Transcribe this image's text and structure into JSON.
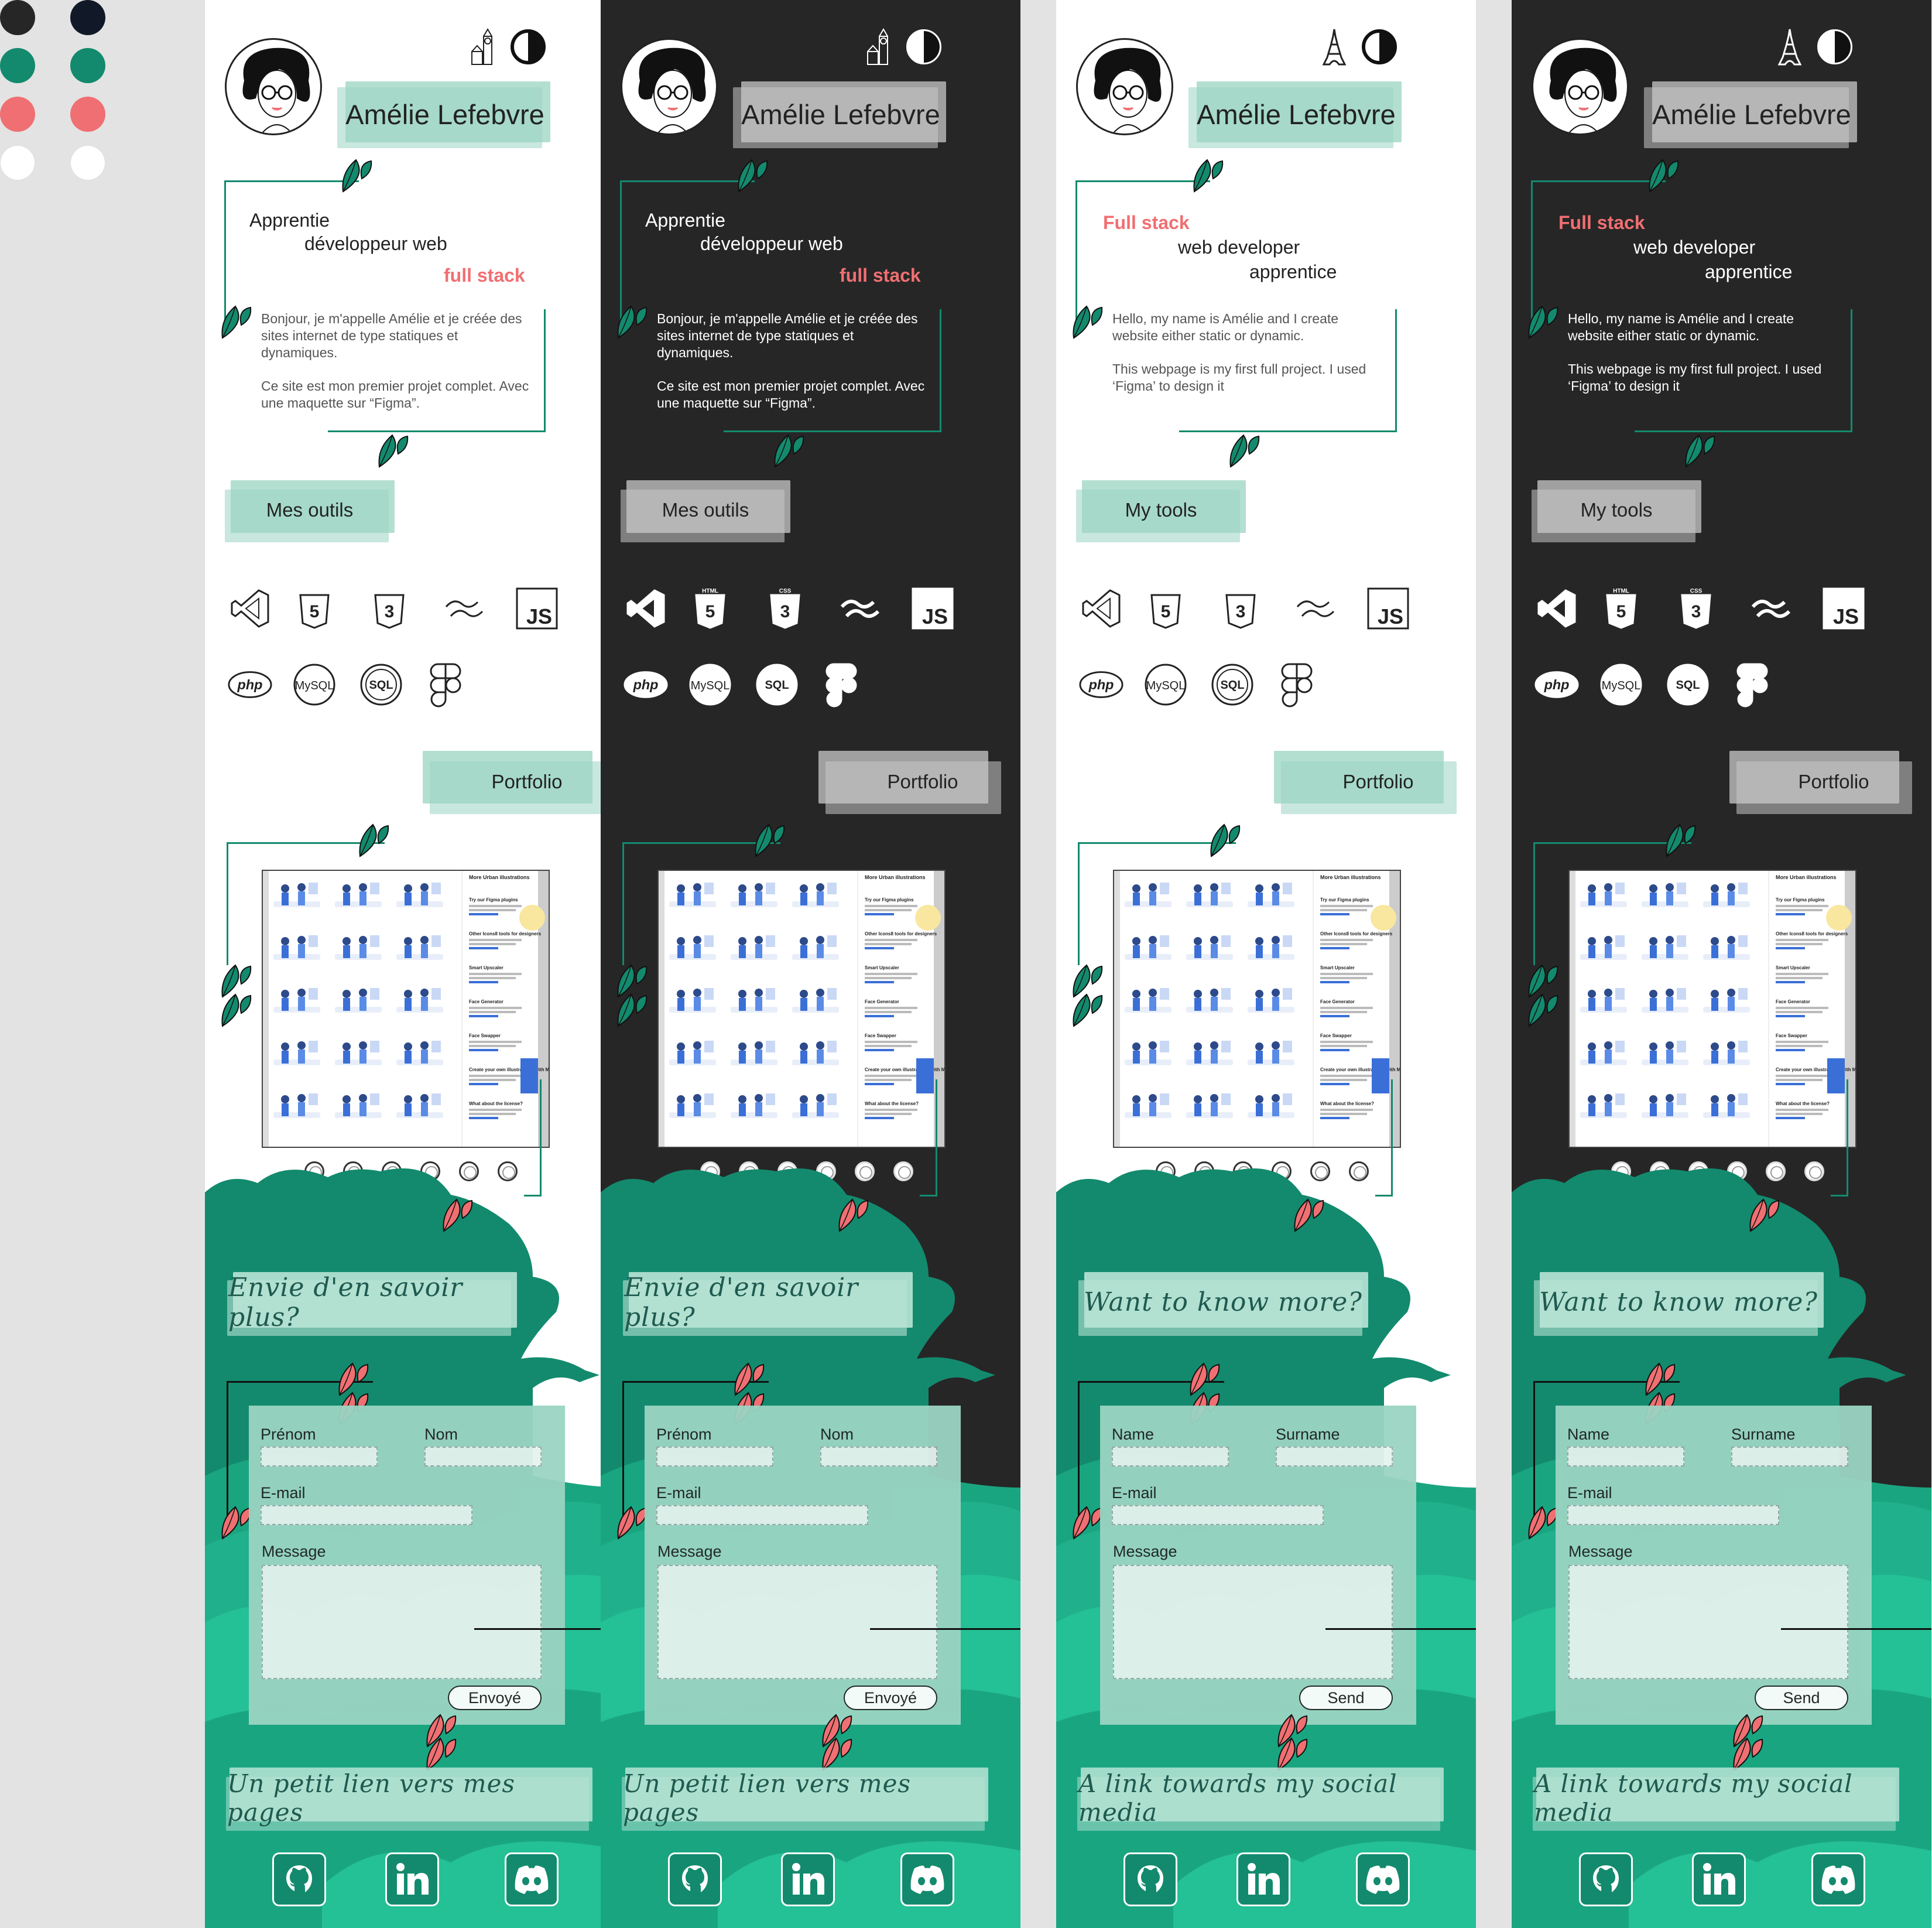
{
  "colors": {
    "dark_bg": "#262626",
    "navy": "#111827",
    "green": "#138a6d",
    "mint": "#9ad4c2",
    "pink": "#f06f72",
    "white": "#ffffff"
  },
  "palette": [
    "#262626",
    "#111827",
    "#138a6d",
    "#138a6d",
    "#f06f72",
    "#f06f72",
    "#ffffff",
    "#ffffff"
  ],
  "icons": {
    "landmark_fr": "big-ben-icon",
    "landmark_en": "eiffel-tower-icon",
    "theme": "contrast-icon",
    "leaf": "leaf-icon"
  },
  "frames": [
    {
      "theme": "light",
      "name": "Amélie Lefebvre",
      "intro": [
        "Apprentie",
        "développeur web",
        "full stack"
      ],
      "bio": [
        "Bonjour, je m'appelle Amélie et je créée des sites internet de type statiques et dynamiques.",
        "Ce site est mon premier projet complet. Avec une maquette sur “Figma”."
      ],
      "tools_label": "Mes outils",
      "portfolio_label": "Portfolio",
      "cta": "Envie d'en savoir plus?",
      "form": {
        "first": "Prénom",
        "last": "Nom",
        "email": "E-mail",
        "message": "Message",
        "send": "Envoyé"
      },
      "links": "Un petit lien vers mes pages"
    },
    {
      "theme": "dark",
      "name": "Amélie Lefebvre",
      "intro": [
        "Apprentie",
        "développeur web",
        "full stack"
      ],
      "bio": [
        "Bonjour, je m'appelle Amélie et je créée des sites internet de type statiques et dynamiques.",
        "Ce site est mon premier projet complet. Avec une maquette sur “Figma”."
      ],
      "tools_label": "Mes outils",
      "portfolio_label": "Portfolio",
      "cta": "Envie d'en savoir plus?",
      "form": {
        "first": "Prénom",
        "last": "Nom",
        "email": "E-mail",
        "message": "Message",
        "send": "Envoyé"
      },
      "links": "Un petit lien vers mes pages"
    },
    {
      "theme": "light",
      "name": "Amélie Lefebvre",
      "intro": [
        "Full stack",
        "web developer",
        "apprentice"
      ],
      "bio": [
        "Hello, my name is Amélie and I create website either static or dynamic.",
        "This webpage is my first full project. I used ‘Figma’ to design it"
      ],
      "tools_label": "My tools",
      "portfolio_label": "Portfolio",
      "cta": "Want to know more?",
      "form": {
        "first": "Name",
        "last": "Surname",
        "email": "E-mail",
        "message": "Message",
        "send": "Send"
      },
      "links": "A link towards my social media"
    },
    {
      "theme": "dark",
      "name": "Amélie Lefebvre",
      "intro": [
        "Full stack",
        "web developer",
        "apprentice"
      ],
      "bio": [
        "Hello, my name is Amélie and I create website either static or dynamic.",
        "This webpage is my first full project. I used ‘Figma’ to design it"
      ],
      "tools_label": "My tools",
      "portfolio_label": "Portfolio",
      "cta": "Want to know more?",
      "form": {
        "first": "Name",
        "last": "Surname",
        "email": "E-mail",
        "message": "Message",
        "send": "Send"
      },
      "links": "A link towards my social media"
    }
  ],
  "tools": {
    "row1": [
      "vscode-icon",
      "html5-icon",
      "css3-icon",
      "tailwind-icon",
      "js-icon"
    ],
    "row2": [
      "php-icon",
      "mysql-icon",
      "sql-icon",
      "figma-icon"
    ],
    "labels": {
      "html": "HTML",
      "css": "CSS",
      "js": "JS",
      "php": "php",
      "mysql": "MySQL",
      "sql": "SQL"
    }
  },
  "portfolio_preview": {
    "title": "More Urban illustrations",
    "items": [
      "Try our Figma plugins",
      "Other Icons8 tools for designers",
      "Smart Upscaler",
      "Face Generator",
      "Face Swapper",
      "Create your own illustrations with Mega Creator",
      "What about the license?"
    ]
  },
  "slider_dots": 6,
  "social": [
    "github-icon",
    "linkedin-icon",
    "discord-icon"
  ]
}
